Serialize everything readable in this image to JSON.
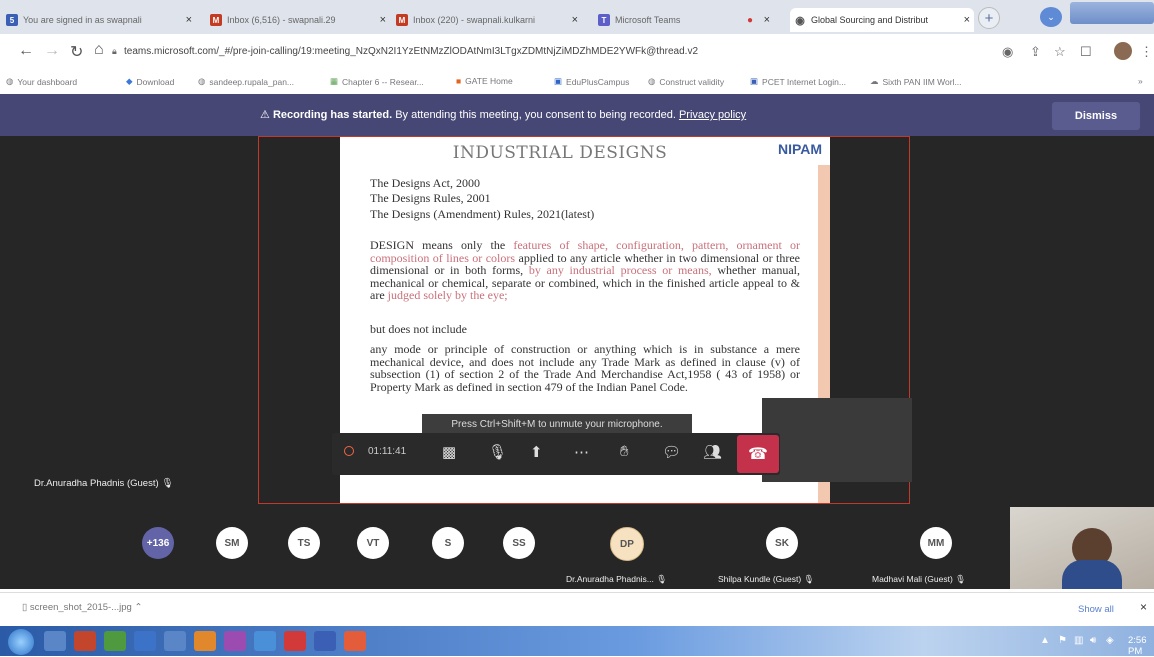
{
  "browser": {
    "tabs": [
      {
        "title": "You are signed in as swapnali",
        "icon_color": "#3a5fb5",
        "icon_text": "5"
      },
      {
        "title": "Inbox (6,516) - swapnali.29",
        "icon_color": "#c23b22",
        "icon_text": "M"
      },
      {
        "title": "Inbox (220) - swapnali.kulkarni",
        "icon_color": "#c23b22",
        "icon_text": "M"
      },
      {
        "title": "Microsoft Teams",
        "icon_color": "#5b5fc7",
        "icon_text": "T"
      },
      {
        "title": "",
        "icon_color": "#d23a3a",
        "icon_text": "●"
      },
      {
        "title": "Global Sourcing and Distribut",
        "icon_color": "#555555",
        "icon_text": "◉"
      }
    ],
    "tab_close": "×",
    "new_tab": "+",
    "url": "teams.microsoft.com/_#/pre-join-calling/19:meeting_NzQxN2I1YzEtNMzZlODAtNmI3LTgxZDMtNjZiMDZhMDE2YWFk@thread.v2",
    "bookmarks": [
      "Your dashboard",
      "Download",
      "sandeep.rupala_pan...",
      "Chapter 6 -- Resear...",
      "GATE Home",
      "EduPlusCampus",
      "Construct validity",
      "PCET Internet Login...",
      "Sixth PAN IIM Worl..."
    ],
    "bookmarks_more": "»"
  },
  "banner": {
    "lead": "Recording has started.",
    "text": " By attending this meeting, you consent to being recorded. ",
    "link": "Privacy policy",
    "dismiss": "Dismiss"
  },
  "slide": {
    "title": "INDUSTRIAL DESIGNS",
    "logo": "NIPAM",
    "acts": [
      "The Designs Act, 2000",
      "The Designs Rules, 2001",
      "The Designs (Amendment) Rules, 2021(latest)"
    ],
    "def_lead": "DESIGN means only the ",
    "def_hl1": "features of shape, configuration, pattern, ornament or composition of lines or colors",
    "def_mid1": " applied to any article whether in two dimensional or three dimensional or in both forms, ",
    "def_hl2": "by any industrial process or means,",
    "def_mid2": " whether manual, mechanical or chemical, separate or combined, which in the finished article appeal to & are ",
    "def_hl3": "judged solely by the eye;",
    "but": "but does not include",
    "exclusion": "any mode or principle of construction or anything which is in substance a mere mechanical device, and does not include any Trade Mark as defined in clause (v) of subsection (1) of section 2 of the Trade And Merchandise Act,1958 ( 43 of 1958) or Property Mark as defined in section 479 of the Indian Panel Code."
  },
  "controls": {
    "tooltip": "Press Ctrl+Shift+M to unmute your microphone.",
    "timer": "01:11:41"
  },
  "speaker_label": "Dr.Anuradha Phadnis (Guest)",
  "participants": {
    "overflow": "+136",
    "avatars": [
      "SM",
      "TS",
      "VT",
      "S",
      "SS"
    ],
    "named": [
      {
        "initials": "DP",
        "name": "Dr.Anuradha Phadnis..."
      },
      {
        "initials": "SK",
        "name": "Shilpa Kundle (Guest)"
      },
      {
        "initials": "MM",
        "name": "Madhavi Mali (Guest)"
      }
    ]
  },
  "downloads": {
    "file": "screen_shot_2015-...jpg",
    "show_all": "Show all",
    "close": "×"
  },
  "taskbar": {
    "clock": "2:56 PM"
  },
  "colors": {
    "teams_banner": "#464775",
    "hangup": "#c4314b",
    "share_border": "#c0392b",
    "avatar_overflow": "#6264a7"
  }
}
